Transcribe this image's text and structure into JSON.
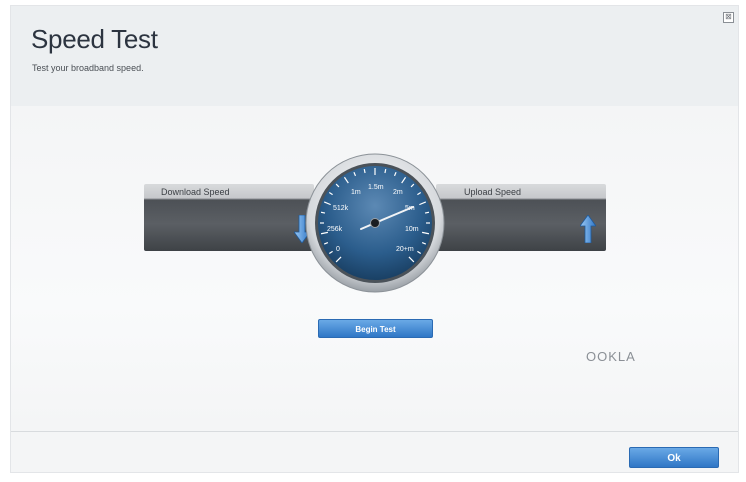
{
  "window": {
    "close_glyph": "⊠"
  },
  "header": {
    "title": "Speed Test",
    "subtitle": "Test your broadband speed."
  },
  "download": {
    "label": "Download Speed",
    "icon": "down-arrow-icon"
  },
  "upload": {
    "label": "Upload Speed",
    "icon": "up-arrow-icon"
  },
  "gauge": {
    "ticks": [
      "0",
      "256k",
      "512k",
      "1m",
      "1.5m",
      "2m",
      "5m",
      "10m",
      "20+m"
    ]
  },
  "actions": {
    "begin_test": "Begin Test",
    "ok": "Ok"
  },
  "brand": {
    "provider": "OOKLA"
  },
  "colors": {
    "accent": "#2f76c6",
    "gauge_face": "#2b5d8c",
    "bar_dark": "#4d5156"
  }
}
